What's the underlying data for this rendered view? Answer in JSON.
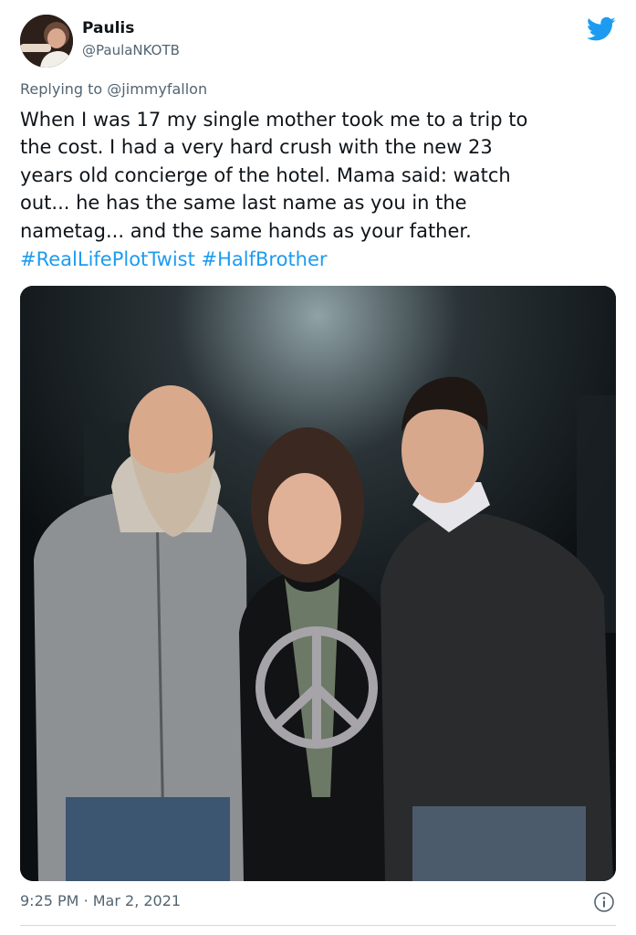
{
  "tweet": {
    "display_name": "Paulis",
    "handle": "@PaulaNKOTB",
    "reply_prefix": "Replying to",
    "reply_to": "@jimmyfallon",
    "text": "When I was 17 my single mother took me to a trip to\nthe cost. I had a very hard crush with the new 23\nyears old concierge of the hotel. Mama said: watch\nout... he has the same last name as you in the\nnametag... and the same hands as your father.",
    "hashtags": [
      "#RealLifePlotTwist",
      "#HalfBrother"
    ],
    "time": "9:25 PM",
    "separator": "·",
    "date": "Mar 2, 2021"
  },
  "icons": {
    "brand": "twitter-bird-icon",
    "info": "info-icon"
  },
  "colors": {
    "link_blue": "#1d9bf0",
    "secondary_text": "#536471",
    "primary_text": "#0f1419"
  }
}
